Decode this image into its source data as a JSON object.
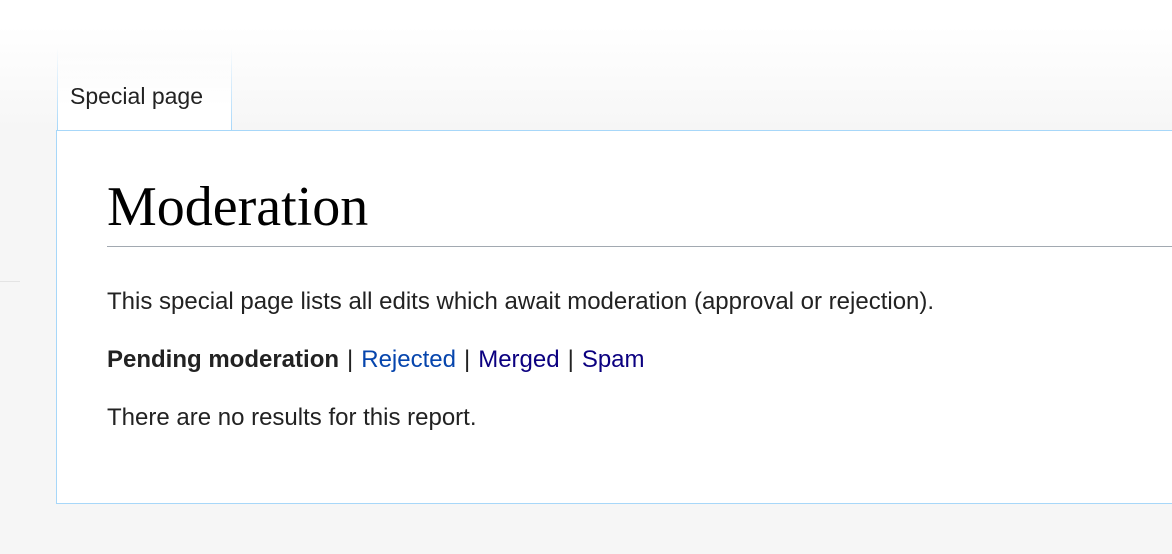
{
  "tabs": {
    "special_page": "Special page"
  },
  "page": {
    "title": "Moderation",
    "intro": "This special page lists all edits which await moderation (approval or rejection).",
    "no_results": "There are no results for this report."
  },
  "filters": {
    "current": "Pending moderation",
    "separator": "|",
    "links": {
      "rejected": "Rejected",
      "merged": "Merged",
      "spam": "Spam"
    }
  },
  "colors": {
    "link": "#0645ad",
    "visited_link": "#0b0080",
    "content_border": "#a7d7f9",
    "heading_rule": "#a2a9b1",
    "text": "#222222",
    "page_background": "#f6f6f6"
  }
}
